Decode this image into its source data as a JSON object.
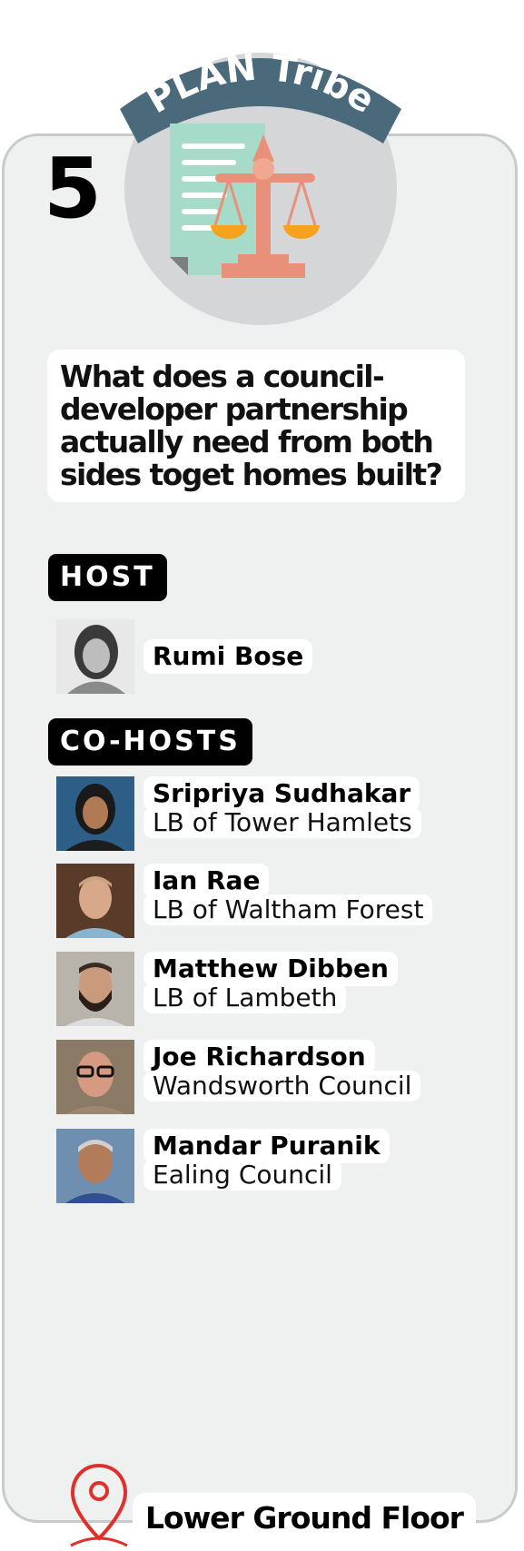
{
  "badge": {
    "text": "PLAN Tribe",
    "banner_color": "#4a6a7c"
  },
  "session_number": "5",
  "question": "What does a council-developer partnership actually need from both sides toget homes built?",
  "host_label": "HOST",
  "cohosts_label": "CO-HOSTS",
  "host": {
    "name": "Rumi Bose"
  },
  "cohosts": [
    {
      "name": "Sripriya Sudhakar",
      "org": "LB of Tower Hamlets"
    },
    {
      "name": "Ian Rae",
      "org": "LB of Waltham Forest"
    },
    {
      "name": "Matthew Dibben",
      "org": "LB of Lambeth"
    },
    {
      "name": "Joe Richardson",
      "org": "Wandsworth Council"
    },
    {
      "name": "Mandar Puranik",
      "org": "Ealing Council"
    }
  ],
  "location": "Lower Ground Floor",
  "colors": {
    "pin": "#e0302b",
    "card_bg": "#eff0f0",
    "tag_bg": "#000000"
  },
  "icons": [
    "document-scales-icon",
    "map-pin-icon"
  ]
}
